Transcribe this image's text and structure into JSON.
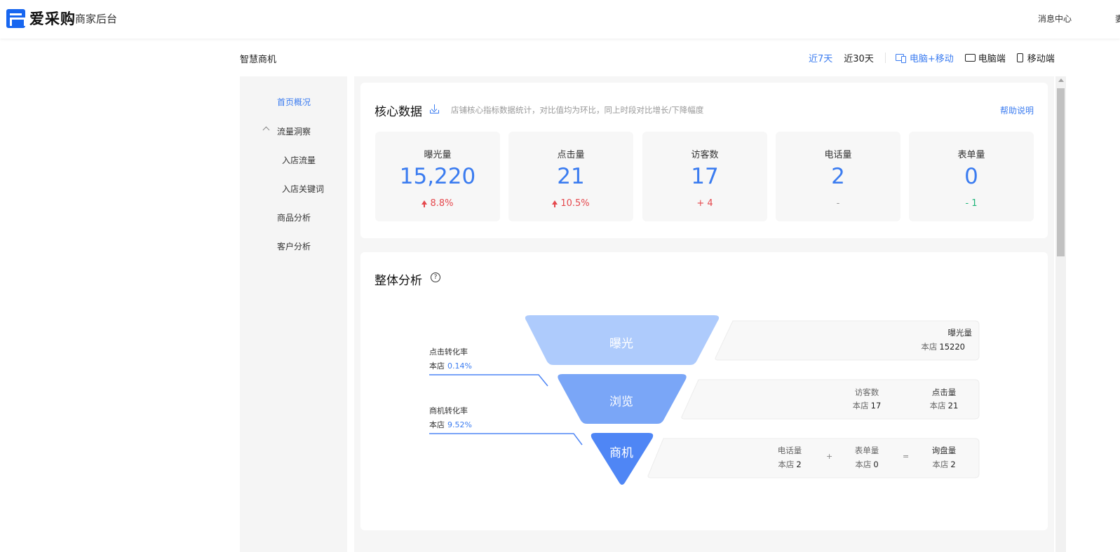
{
  "header": {
    "brand": "爱采购",
    "subtitle": "商家后台",
    "message_center": "消息中心",
    "edge_glyph": "妻"
  },
  "page": {
    "title": "智慧商机",
    "range_tabs": [
      {
        "label": "近7天",
        "active": true
      },
      {
        "label": "近30天",
        "active": false
      }
    ],
    "device_tabs": [
      {
        "label": "电脑+移动",
        "icon": "pc-mobile-icon",
        "active": true
      },
      {
        "label": "电脑端",
        "icon": "monitor-icon",
        "active": false
      },
      {
        "label": "移动端",
        "icon": "mobile-icon",
        "active": false
      }
    ]
  },
  "sidebar": {
    "items": [
      {
        "label": "首页概况",
        "active": true
      },
      {
        "label": "流量洞察",
        "expanded": true
      },
      {
        "label": "入店流量"
      },
      {
        "label": "入店关键词"
      },
      {
        "label": "商品分析"
      },
      {
        "label": "客户分析"
      }
    ]
  },
  "core": {
    "title": "核心数据",
    "description": "店铺核心指标数据统计，对比值均为环比，同上时段对比增长/下降幅度",
    "help": "帮助说明",
    "metrics": [
      {
        "label": "曝光量",
        "value": "15,220",
        "change": "8.8%",
        "trend": "up"
      },
      {
        "label": "点击量",
        "value": "21",
        "change": "10.5%",
        "trend": "up"
      },
      {
        "label": "访客数",
        "value": "17",
        "change": "+ 4",
        "trend": "up-plain"
      },
      {
        "label": "电话量",
        "value": "2",
        "change": "-",
        "trend": "none"
      },
      {
        "label": "表单量",
        "value": "0",
        "change": "- 1",
        "trend": "down"
      }
    ]
  },
  "analysis": {
    "title": "整体分析",
    "help_icon": "?",
    "stages": [
      "曝光",
      "浏览",
      "商机"
    ],
    "colors": {
      "stage1": "#aecbfc",
      "stage2": "#7aa6f7",
      "stage3": "#4f86f5",
      "line": "#4f86f5"
    },
    "conversions": [
      {
        "label": "点击转化率",
        "prefix": "本店",
        "value": "0.14%"
      },
      {
        "label": "商机转化率",
        "prefix": "本店",
        "value": "9.52%"
      }
    ],
    "boxes": {
      "exposure": {
        "label": "曝光量",
        "prefix": "本店",
        "value": "15220"
      },
      "browse": [
        {
          "label": "访客数",
          "prefix": "本店",
          "value": "17"
        },
        {
          "label": "点击量",
          "prefix": "本店",
          "value": "21"
        }
      ],
      "lead": [
        {
          "label": "电话量",
          "prefix": "本店",
          "value": "2"
        },
        {
          "label": "表单量",
          "prefix": "本店",
          "value": "0"
        },
        {
          "label": "询盘量",
          "prefix": "本店",
          "value": "2"
        }
      ],
      "ops": [
        "+",
        "="
      ]
    }
  }
}
